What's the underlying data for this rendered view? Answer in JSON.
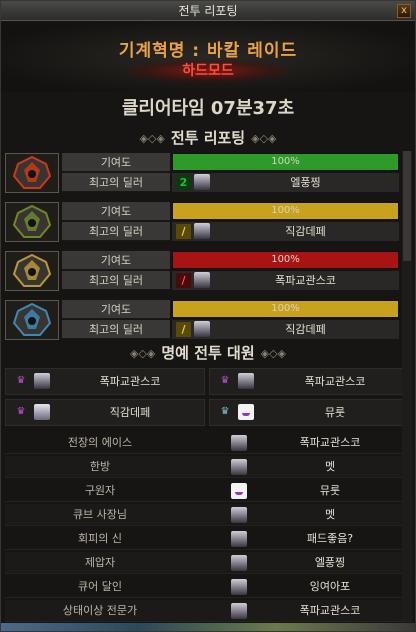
{
  "window": {
    "title": "전투 리포팅",
    "close_label": "x"
  },
  "raid": {
    "title": "기계혁명 : 바칼 레이드",
    "mode": "하드모드"
  },
  "clear_time": "클리어타임  07분37초",
  "sections": {
    "combat": "전투 리포팅",
    "honor": "명예 전투 대원"
  },
  "labels": {
    "contribution": "기여도",
    "best_dealer": "최고의 딜러"
  },
  "parties": [
    {
      "contribution": "100%",
      "contribution_fraction": 1.0,
      "bar_color": "#2e9a2a",
      "bar_bg": "#2e9a2a",
      "badge": "2",
      "badge_color": "#1ec038",
      "badge_bg": "#0c3a10",
      "dealer": "엘풍찡",
      "portrait": "red-crest-portrait"
    },
    {
      "contribution": "100%",
      "contribution_fraction": 1.0,
      "bar_color": "#c8a21c",
      "bar_bg": "#c8a21c",
      "badge": "/",
      "badge_color": "#f0d040",
      "badge_bg": "#5a4a08",
      "dealer": "직감데페",
      "portrait": "green-crest-portrait"
    },
    {
      "contribution": "100%",
      "contribution_fraction": 1.0,
      "bar_color": "#a81414",
      "bar_bg": "#a81414",
      "badge": "/",
      "badge_color": "#ff5050",
      "badge_bg": "#4a0a0a",
      "dealer": "폭파교관스코",
      "portrait": "gold-crest-portrait"
    },
    {
      "contribution": "100%",
      "contribution_fraction": 1.0,
      "bar_color": "#c8a21c",
      "bar_bg": "#c8a21c",
      "badge": "/",
      "badge_color": "#f0d040",
      "badge_bg": "#5a4a08",
      "dealer": "직감데페",
      "portrait": "blue-crest-portrait"
    }
  ],
  "honor": [
    {
      "name": "폭파교관스코"
    },
    {
      "name": "폭파교관스코"
    },
    {
      "name": "직감데페"
    },
    {
      "name": "뮤룻"
    }
  ],
  "awards": [
    {
      "title": "전장의 에이스",
      "player": "폭파교관스코"
    },
    {
      "title": "한방",
      "player": "멧"
    },
    {
      "title": "구원자",
      "player": "뮤룻"
    },
    {
      "title": "큐브 사장님",
      "player": "멧"
    },
    {
      "title": "회피의 신",
      "player": "패드좋음?"
    },
    {
      "title": "제압자",
      "player": "엘풍찡"
    },
    {
      "title": "큐어 달인",
      "player": "잉여아포"
    },
    {
      "title": "상태이상 전문가",
      "player": "폭파교관스코"
    }
  ]
}
